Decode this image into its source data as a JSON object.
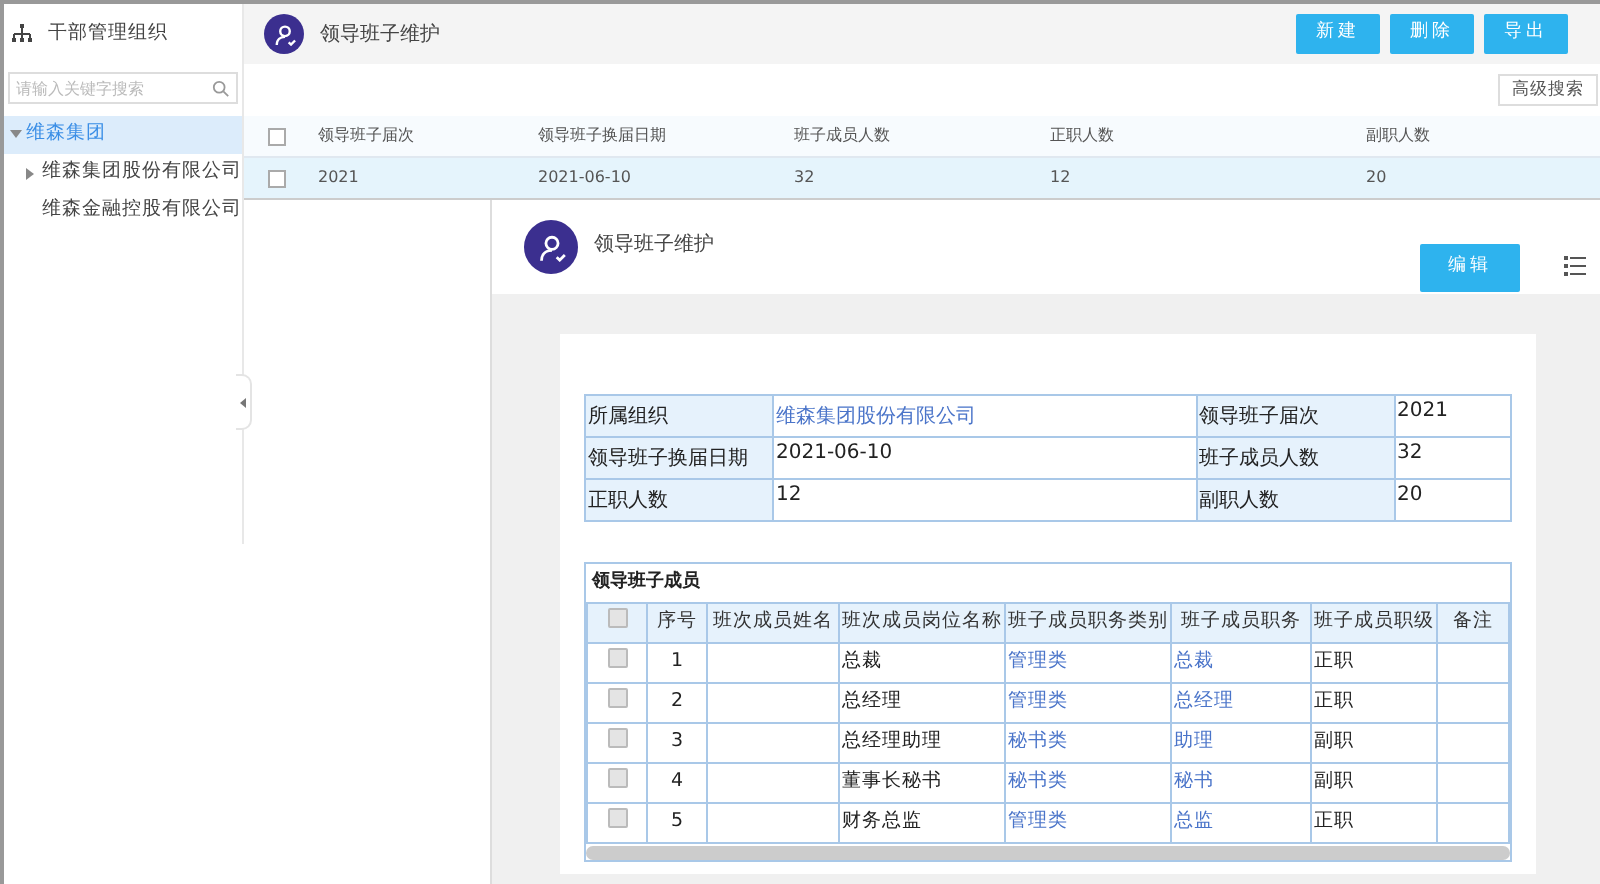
{
  "sidebar": {
    "title": "干部管理组织",
    "search": {
      "placeholder": "请输入关键字搜索"
    },
    "tree": [
      {
        "label": "维森集团",
        "kind": "branch",
        "expanded": true,
        "selected": true,
        "children": [
          {
            "label": "维森集团股份有限公司",
            "kind": "branch",
            "expanded": false,
            "selected": false
          },
          {
            "label": "维森金融控股有限公司",
            "kind": "leaf",
            "expanded": false,
            "selected": false
          }
        ]
      }
    ]
  },
  "header": {
    "title": "领导班子维护",
    "buttons": [
      "新建",
      "删除",
      "导出"
    ]
  },
  "toolbar": {
    "advanced_search": "高级搜索"
  },
  "list": {
    "header_checked": false,
    "columns": [
      "领导班子届次",
      "领导班子换届日期",
      "班子成员人数",
      "正职人数",
      "副职人数"
    ],
    "rows": [
      {
        "cells": [
          "2021",
          "2021-06-10",
          "32",
          "12",
          "20"
        ],
        "checked": false,
        "selected": true
      }
    ]
  },
  "detail": {
    "title": "领导班子维护",
    "edit_button": "编辑",
    "info": [
      {
        "label": "所属组织",
        "value": "维森集团股份有限公司",
        "kind": "link"
      },
      {
        "label": "领导班子届次",
        "value": "2021",
        "kind": "text"
      },
      {
        "label": "领导班子换届日期",
        "value": "2021-06-10",
        "kind": "text"
      },
      {
        "label": "班子成员人数",
        "value": "32",
        "kind": "text"
      },
      {
        "label": "正职人数",
        "value": "12",
        "kind": "text"
      },
      {
        "label": "副职人数",
        "value": "20",
        "kind": "text"
      }
    ],
    "members": {
      "title": "领导班子成员",
      "header_checked": false,
      "columns": [
        "序号",
        "班次成员姓名",
        "班次成员岗位名称",
        "班子成员职务类别",
        "班子成员职务",
        "班子成员职级",
        "备注"
      ],
      "rows": [
        {
          "no": "1",
          "position": "总裁",
          "category": "管理类",
          "duty": "总裁",
          "level": "正职",
          "checked": false
        },
        {
          "no": "2",
          "position": "总经理",
          "category": "管理类",
          "duty": "总经理",
          "level": "正职",
          "checked": false
        },
        {
          "no": "3",
          "position": "总经理助理",
          "category": "秘书类",
          "duty": "助理",
          "level": "副职",
          "checked": false
        },
        {
          "no": "4",
          "position": "董事长秘书",
          "category": "秘书类",
          "duty": "秘书",
          "level": "副职",
          "checked": false
        },
        {
          "no": "5",
          "position": "财务总监",
          "category": "管理类",
          "duty": "总监",
          "level": "正职",
          "checked": false
        }
      ]
    }
  }
}
